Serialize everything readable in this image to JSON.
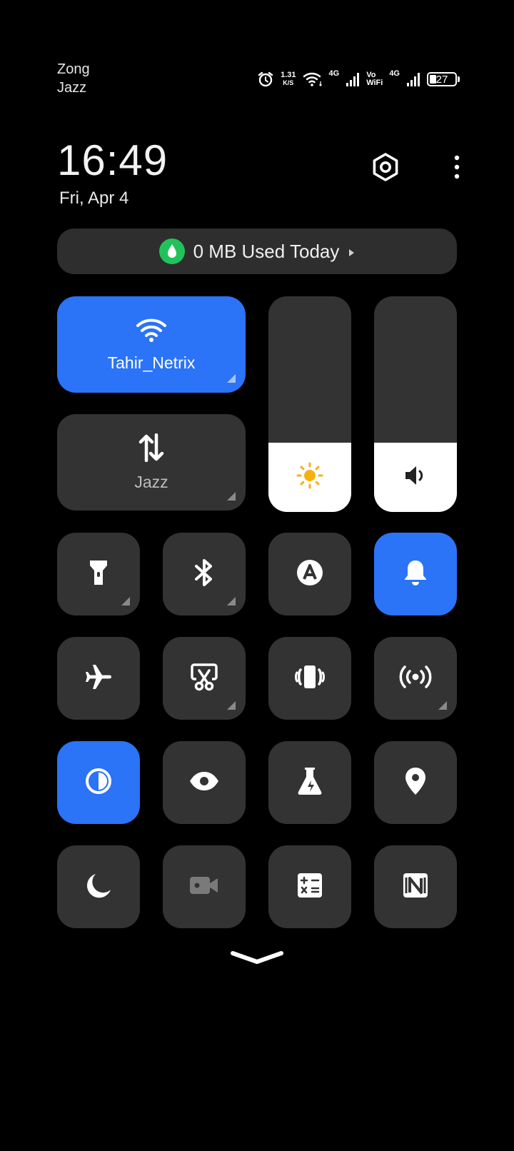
{
  "status_bar": {
    "carrier_1": "Zong",
    "carrier_2": "Jazz",
    "net_speed_value": "1.31",
    "net_speed_unit": "K/S",
    "sim1_type": "4G",
    "vowifi_top": "Vo",
    "vowifi_bottom": "WiFi",
    "sim2_type": "4G",
    "battery_level": "27",
    "icons": [
      "alarm-icon",
      "wifi-icon",
      "signal-icon",
      "signal-icon",
      "battery-icon"
    ]
  },
  "header": {
    "time": "16:49",
    "date": "Fri, Apr 4",
    "settings_icon": "settings-hexagon-icon",
    "menu_icon": "more-vertical-icon"
  },
  "data_usage": {
    "label": "0 MB Used Today",
    "icon": "water-drop-icon",
    "icon_color": "#22c25b"
  },
  "wifi_tile": {
    "label": "Tahir_Netrix",
    "active": true
  },
  "mobile_data_tile": {
    "label": "Jazz",
    "active": false
  },
  "sliders": {
    "brightness_level": 0.32,
    "volume_level": 0.32
  },
  "colors": {
    "accent": "#2b73f7",
    "tile": "#333333",
    "background": "#000000",
    "sun": "#f6b10f"
  },
  "quick_toggles": [
    {
      "name": "flashlight",
      "active": false
    },
    {
      "name": "bluetooth",
      "active": false
    },
    {
      "name": "auto-brightness",
      "active": false
    },
    {
      "name": "ring-mode",
      "active": true
    },
    {
      "name": "airplane-mode",
      "active": false
    },
    {
      "name": "screenshot",
      "active": false
    },
    {
      "name": "vibrate",
      "active": false
    },
    {
      "name": "hotspot",
      "active": false
    },
    {
      "name": "dark-mode",
      "active": true
    },
    {
      "name": "eye-comfort",
      "active": false
    },
    {
      "name": "lab",
      "active": false
    },
    {
      "name": "location",
      "active": false
    },
    {
      "name": "do-not-disturb",
      "active": false
    },
    {
      "name": "screen-record",
      "active": false
    },
    {
      "name": "calculator",
      "active": false
    },
    {
      "name": "nfc",
      "active": false
    }
  ]
}
